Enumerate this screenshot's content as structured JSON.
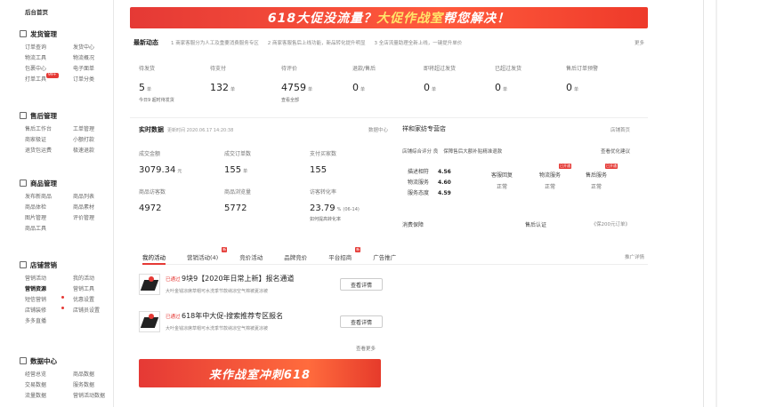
{
  "sidebar": {
    "home": "后台首页",
    "groups": [
      {
        "title": "发货管理",
        "items": [
          "订单查询",
          "发货中心",
          "物流工具",
          "物流概况",
          "包裹中心",
          "电子面单",
          "打单工具",
          "订单分类"
        ],
        "hot_badge": "99+"
      },
      {
        "title": "售后管理",
        "items": [
          "售后工作台",
          "工单管理",
          "商家极证",
          "小额打款",
          "退货包运费",
          "极速退款"
        ]
      },
      {
        "title": "商品管理",
        "items": [
          "发布新商品",
          "商品列表",
          "商品体检",
          "商品素材",
          "图片管理",
          "评价管理",
          "商品工具"
        ]
      },
      {
        "title": "店铺营销",
        "items": [
          "营销活动",
          "我的活动",
          "营销资源",
          "营销工具",
          "短信营销",
          "优惠设置",
          "店铺装修",
          "店铺员设置",
          "多多直播"
        ],
        "active": "营销资源"
      },
      {
        "title": "数据中心",
        "items": [
          "经营总览",
          "商品数据",
          "交易数据",
          "服务数据",
          "流量数据",
          "营销活动数据"
        ]
      }
    ]
  },
  "banner_top": {
    "part1": "618大促没流量？",
    "part2": "大促作战室",
    "part3": "帮您解决！"
  },
  "news": {
    "title": "最新动态",
    "items": [
      "1  商家客服分为人工及重要消费服务专区",
      "2  商家客服售后上线功能，新品转化提升明显",
      "3  全店流量助理全新上线，一键提升单价"
    ],
    "more": "更多"
  },
  "stats": [
    {
      "label": "待发货",
      "value": "5",
      "unit": "单",
      "sub": "今日9  超时待发货"
    },
    {
      "label": "待支付",
      "value": "132",
      "unit": "单",
      "sub": ""
    },
    {
      "label": "待评价",
      "value": "4759",
      "unit": "单",
      "sub": "查看全部"
    },
    {
      "label": "退款/售后",
      "value": "0",
      "unit": "单",
      "sub": ""
    },
    {
      "label": "即将超过发货",
      "value": "0",
      "unit": "单",
      "sub": ""
    },
    {
      "label": "已超过发货",
      "value": "0",
      "unit": "单",
      "sub": ""
    },
    {
      "label": "售后订单预警",
      "value": "0",
      "unit": "单",
      "sub": ""
    }
  ],
  "realtime": {
    "title": "实时数据",
    "updated": "更新时间 2020.06.17 14:20:38",
    "more": "数据中心",
    "cells": [
      {
        "label": "成交金额",
        "value": "3079.34",
        "unit": "元"
      },
      {
        "label": "成交订单数",
        "value": "155",
        "unit": "单"
      },
      {
        "label": "支付买家数",
        "value": "155",
        "unit": ""
      },
      {
        "label": "商品访客数",
        "value": "4972",
        "unit": ""
      },
      {
        "label": "商品浏览量",
        "value": "5772",
        "unit": ""
      },
      {
        "label": "访客转化率",
        "value": "23.79",
        "unit": "%",
        "small": "(06-14)",
        "sub": "如何提高转化率"
      }
    ]
  },
  "store": {
    "title": "祥和家纺专营店",
    "link": "店铺首页",
    "row_label": "店铺综合评分  良",
    "row_text": "保障售后大额补贴精准退款",
    "row_right": "查看优化建议",
    "scores": [
      {
        "name": "描述相符",
        "value": "4.56"
      },
      {
        "name": "物流服务",
        "value": "4.60"
      },
      {
        "name": "服务态度",
        "value": "4.59"
      }
    ],
    "services": [
      {
        "name": "客服回复",
        "status": "正常",
        "tag": ""
      },
      {
        "name": "物流服务",
        "status": "正常",
        "tag": "已开通"
      },
      {
        "name": "售后服务",
        "status": "正常",
        "tag": "已开通"
      }
    ],
    "bottom_left": "消费保障",
    "bottom_mid": "售后认证",
    "bottom_right": "《保200元订单》"
  },
  "tabs": {
    "items": [
      {
        "label": "我的活动",
        "badge": ""
      },
      {
        "label": "营销活动(4)",
        "badge": "新"
      },
      {
        "label": "竞价活动",
        "badge": ""
      },
      {
        "label": "品牌竞价",
        "badge": ""
      },
      {
        "label": "平台招商",
        "badge": "新"
      },
      {
        "label": "广告推广",
        "badge": ""
      }
    ],
    "more": "推广详情"
  },
  "activities": [
    {
      "status": "已通过",
      "name": "9块9【2020年日常上新】报名通道",
      "desc": "大叶金钱凉席草帽可水洗季节款纳凉空气棉被夏凉被",
      "button": "查看详情"
    },
    {
      "status": "已通过",
      "name": "618年中大促-搜索推荐专区报名",
      "desc": "大叶金钱凉席草帽可水洗季节款纳凉空气棉被夏凉被",
      "button": "查看详情"
    }
  ],
  "view_more": "查看更多",
  "banner_bottom": "来作战室冲刺618"
}
